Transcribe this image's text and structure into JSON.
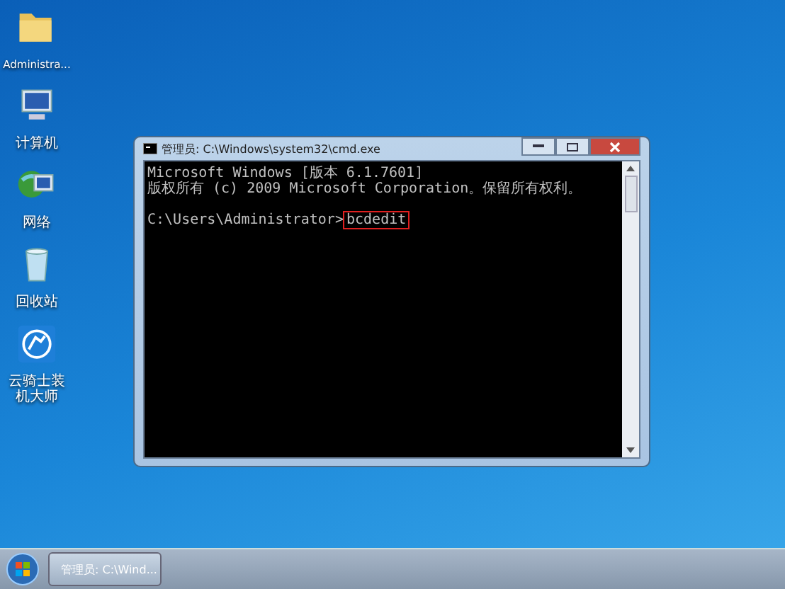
{
  "desktop_icons": [
    {
      "kind": "folder",
      "label": "Administra..."
    },
    {
      "kind": "computer",
      "label": "计算机"
    },
    {
      "kind": "network",
      "label": "网络"
    },
    {
      "kind": "recycle",
      "label": "回收站"
    },
    {
      "kind": "app",
      "label": "云骑士装机大师"
    }
  ],
  "window": {
    "title": "管理员: C:\\Windows\\system32\\cmd.exe",
    "lines": [
      {
        "kind": "output",
        "text": "Microsoft Windows [版本 6.1.7601]"
      },
      {
        "kind": "output",
        "text": "版权所有 (c) 2009 Microsoft Corporation。保留所有权利。"
      },
      {
        "kind": "blank"
      },
      {
        "kind": "prompt",
        "text": "C:\\Users\\Administrator>",
        "command": "bcdedit",
        "highlighted": true
      }
    ]
  },
  "taskbar": {
    "items": [
      {
        "label": "管理员: C:\\Wind...",
        "selected": true
      }
    ]
  }
}
